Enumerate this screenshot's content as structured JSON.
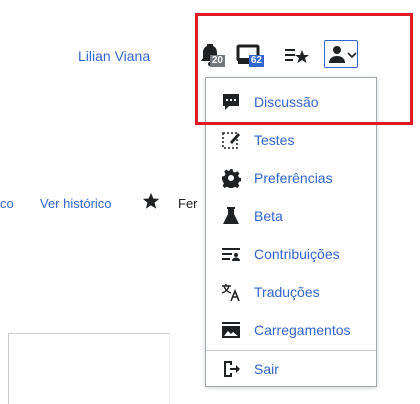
{
  "header": {
    "user_name": "Lilian Viana",
    "notifications_alerts_count": "20",
    "notifications_notices_count": "62"
  },
  "tabs": {
    "prefix": "co",
    "history": "Ver histórico",
    "truncated": "Fer"
  },
  "user_menu": {
    "items": [
      {
        "label": "Discussão",
        "icon": "talk-icon"
      },
      {
        "label": "Testes",
        "icon": "sandbox-icon"
      },
      {
        "label": "Preferências",
        "icon": "gear-icon"
      },
      {
        "label": "Beta",
        "icon": "labflask-icon"
      },
      {
        "label": "Contribuições",
        "icon": "contributions-icon"
      },
      {
        "label": "Traduções",
        "icon": "translate-icon"
      },
      {
        "label": "Carregamentos",
        "icon": "image-gallery-icon"
      },
      {
        "label": "Sair",
        "icon": "logout-icon"
      }
    ]
  },
  "colors": {
    "link": "#3366cc",
    "highlight": "#e01a25",
    "badge_alerts": "#72777d",
    "badge_notices": "#3366cc"
  }
}
